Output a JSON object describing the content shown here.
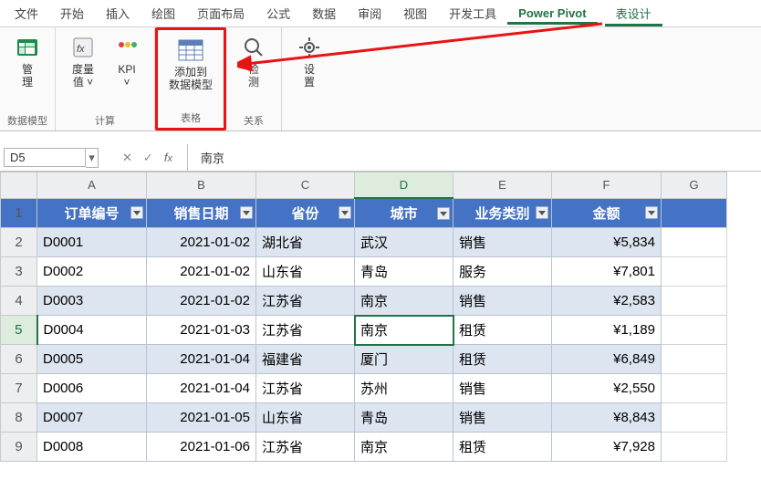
{
  "tabs": {
    "file": "文件",
    "home": "开始",
    "insert": "插入",
    "draw": "绘图",
    "layout": "页面布局",
    "formulas": "公式",
    "data": "数据",
    "review": "审阅",
    "view": "视图",
    "dev": "开发工具",
    "powerpivot": "Power Pivot",
    "tabledesign": "表设计"
  },
  "ribbon": {
    "manage": {
      "label": "管\n理",
      "group": "数据模型"
    },
    "measure": "度量\n值 ˅",
    "kpi": "KPI\n˅",
    "calc_group": "计算",
    "add_model": "添加到\n数据模型",
    "table_group": "表格",
    "detect": "检\n测",
    "rel_group": "关系",
    "settings": "设\n置"
  },
  "formula_bar": {
    "name_box": "D5",
    "formula": "南京"
  },
  "columns": [
    "A",
    "B",
    "C",
    "D",
    "E",
    "F",
    "G"
  ],
  "row_numbers": [
    "1",
    "2",
    "3",
    "4",
    "5",
    "6",
    "7",
    "8",
    "9"
  ],
  "headers": [
    "订单编号",
    "销售日期",
    "省份",
    "城市",
    "业务类别",
    "金额"
  ],
  "rows": [
    {
      "id": "D0001",
      "date": "2021-01-02",
      "prov": "湖北省",
      "city": "武汉",
      "cat": "销售",
      "amt": "¥5,834"
    },
    {
      "id": "D0002",
      "date": "2021-01-02",
      "prov": "山东省",
      "city": "青岛",
      "cat": "服务",
      "amt": "¥7,801"
    },
    {
      "id": "D0003",
      "date": "2021-01-02",
      "prov": "江苏省",
      "city": "南京",
      "cat": "销售",
      "amt": "¥2,583"
    },
    {
      "id": "D0004",
      "date": "2021-01-03",
      "prov": "江苏省",
      "city": "南京",
      "cat": "租赁",
      "amt": "¥1,189"
    },
    {
      "id": "D0005",
      "date": "2021-01-04",
      "prov": "福建省",
      "city": "厦门",
      "cat": "租赁",
      "amt": "¥6,849"
    },
    {
      "id": "D0006",
      "date": "2021-01-04",
      "prov": "江苏省",
      "city": "苏州",
      "cat": "销售",
      "amt": "¥2,550"
    },
    {
      "id": "D0007",
      "date": "2021-01-05",
      "prov": "山东省",
      "city": "青岛",
      "cat": "销售",
      "amt": "¥8,843"
    },
    {
      "id": "D0008",
      "date": "2021-01-06",
      "prov": "江苏省",
      "city": "南京",
      "cat": "租赁",
      "amt": "¥7,928"
    }
  ]
}
